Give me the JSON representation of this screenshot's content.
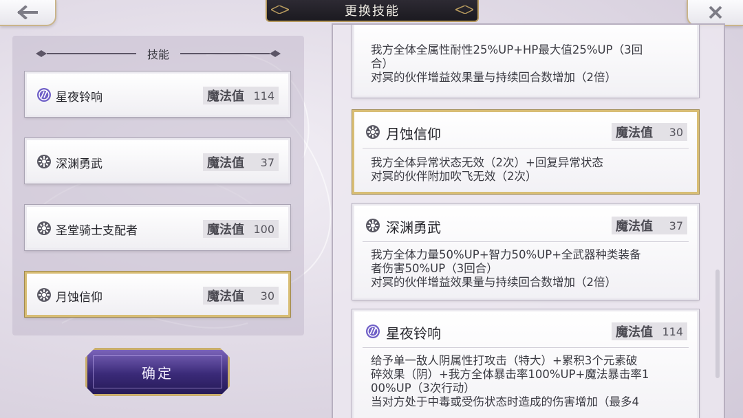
{
  "header": {
    "title": "更换技能"
  },
  "left": {
    "section_title": "技能",
    "skills": [
      {
        "name": "星夜铃响",
        "mp_label": "魔法值",
        "mp": "114",
        "icon": "magic-circle-icon",
        "selected": false
      },
      {
        "name": "深渊勇武",
        "mp_label": "魔法值",
        "mp": "37",
        "icon": "gear-flower-icon",
        "selected": false
      },
      {
        "name": "圣堂骑士支配者",
        "mp_label": "魔法值",
        "mp": "100",
        "icon": "gear-flower-icon",
        "selected": false
      },
      {
        "name": "月蚀信仰",
        "mp_label": "魔法值",
        "mp": "30",
        "icon": "gear-flower-icon",
        "selected": true
      }
    ],
    "confirm_label": "确定"
  },
  "details": [
    {
      "name": "",
      "mp_label": "",
      "mp": "",
      "lines": [
        "我方全体全属性耐性25%UP+HP最大值25%UP（3回",
        "合）",
        "对冥的伙伴增益效果量与持续回合数增加（2倍）"
      ]
    },
    {
      "name": "月蚀信仰",
      "mp_label": "魔法值",
      "mp": "30",
      "icon": "gear-flower-icon",
      "selected": true,
      "lines": [
        "我方全体异常状态无效（2次）+回复异常状态",
        "对冥的伙伴附加吹飞无效（2次）"
      ]
    },
    {
      "name": "深渊勇武",
      "mp_label": "魔法值",
      "mp": "37",
      "icon": "gear-flower-icon",
      "selected": false,
      "lines": [
        "我方全体力量50%UP+智力50%UP+全武器种类装备",
        "者伤害50%UP（3回合）",
        "对冥的伙伴增益效果量与持续回合数增加（2倍）"
      ]
    },
    {
      "name": "星夜铃响",
      "mp_label": "魔法值",
      "mp": "114",
      "icon": "magic-circle-icon",
      "selected": false,
      "lines": [
        "给予单一敌人阴属性打攻击（特大）+累积3个元素破",
        "碎效果（阴）+我方全体暴击率100%UP+魔法暴击率1",
        "00%UP（3次行动）",
        "当对方处于中毒或受伤状态时造成的伤害增加（最多4"
      ]
    }
  ],
  "colors": {
    "gold_border": "#d8bd74",
    "confirm_purple": "#3a2a78",
    "title_bar": "#1b1a20"
  }
}
